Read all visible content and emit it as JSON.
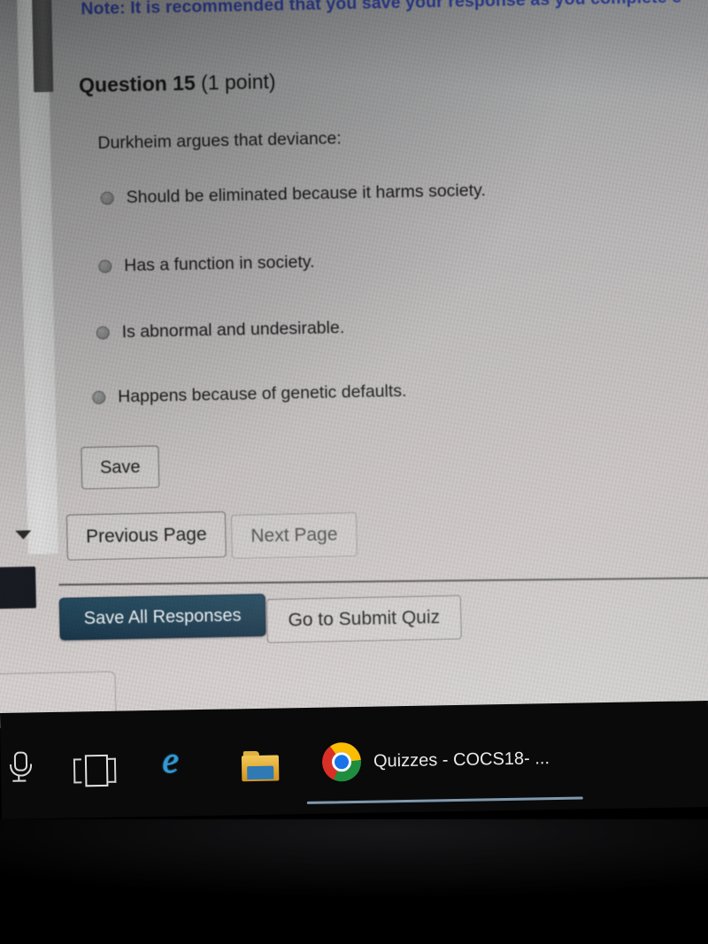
{
  "note": {
    "label": "Note:",
    "text": " It is recommended that you save your response as you complete e",
    "color": "#2b3a8e"
  },
  "question": {
    "heading": "Question 15",
    "points": " (1 point)",
    "stem": "Durkheim argues that deviance:",
    "options": [
      {
        "label": "Should be eliminated because it harms society.",
        "selected": false
      },
      {
        "label": "Has a function in society.",
        "selected": false
      },
      {
        "label": "Is abnormal and undesirable.",
        "selected": false
      },
      {
        "label": "Happens because of genetic defaults.",
        "selected": false
      }
    ]
  },
  "buttons": {
    "save": "Save",
    "previous_page": "Previous Page",
    "next_page": "Next Page",
    "save_all_responses": "Save All Responses",
    "go_to_submit_quiz": "Go to Submit Quiz"
  },
  "right_edge_partial_text": "P",
  "taskbar": {
    "background_color": "#0a0a0b",
    "items": [
      {
        "icon": "microphone-icon",
        "label": ""
      },
      {
        "icon": "task-view-icon",
        "label": ""
      },
      {
        "icon": "internet-explorer-icon",
        "label": "e"
      },
      {
        "icon": "file-explorer-icon",
        "label": ""
      },
      {
        "icon": "chrome-icon",
        "label": "Quizzes - COCS18- ..."
      }
    ],
    "active_window_label": "Quizzes - COCS18- ...",
    "active_indicator_color": "#7f98ad"
  },
  "theme": {
    "save_all_button_color": "#1d3e52",
    "page_background": "#b2b0b1",
    "text_color": "#1a1a1a"
  }
}
